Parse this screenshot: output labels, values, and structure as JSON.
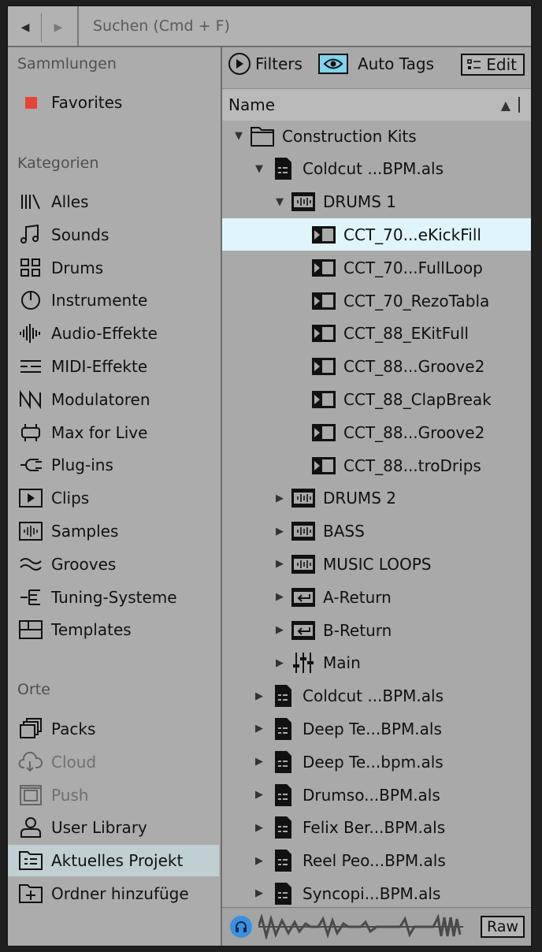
{
  "search": {
    "placeholder": "Suchen (Cmd + F)"
  },
  "sidebar": {
    "collections_header": "Sammlungen",
    "favorites_label": "Favorites",
    "favorites_color": "#e8433a",
    "categories_header": "Kategorien",
    "categories": [
      {
        "label": "Alles",
        "icon": "library-icon"
      },
      {
        "label": "Sounds",
        "icon": "music-note-icon"
      },
      {
        "label": "Drums",
        "icon": "drum-grid-icon"
      },
      {
        "label": "Instrumente",
        "icon": "power-knob-icon"
      },
      {
        "label": "Audio-Effekte",
        "icon": "waveform-icon"
      },
      {
        "label": "MIDI-Effekte",
        "icon": "midi-lines-icon"
      },
      {
        "label": "Modulatoren",
        "icon": "modulator-icon"
      },
      {
        "label": "Max for Live",
        "icon": "max-device-icon"
      },
      {
        "label": "Plug-ins",
        "icon": "plug-icon"
      },
      {
        "label": "Clips",
        "icon": "clip-icon"
      },
      {
        "label": "Samples",
        "icon": "sample-icon"
      },
      {
        "label": "Grooves",
        "icon": "groove-icon"
      },
      {
        "label": "Tuning-Systeme",
        "icon": "tuning-icon"
      },
      {
        "label": "Templates",
        "icon": "template-icon"
      }
    ],
    "places_header": "Orte",
    "places": [
      {
        "label": "Packs",
        "icon": "packs-icon"
      },
      {
        "label": "Cloud",
        "icon": "cloud-icon"
      },
      {
        "label": "Push",
        "icon": "push-icon"
      },
      {
        "label": "User Library",
        "icon": "user-icon"
      },
      {
        "label": "Aktuelles Projekt",
        "icon": "project-icon"
      },
      {
        "label": "Ordner hinzufüge",
        "icon": "add-folder-icon"
      }
    ]
  },
  "toolbar": {
    "filters_label": "Filters",
    "auto_tags_label": "Auto Tags",
    "edit_label": "Edit"
  },
  "browser": {
    "column_header": "Name",
    "rows": [
      {
        "label": "Construction Kits",
        "depth": 0,
        "expand": "open",
        "icon": "folder-icon"
      },
      {
        "label": "Coldcut ...BPM.als",
        "depth": 1,
        "expand": "open",
        "icon": "set-file-icon"
      },
      {
        "label": "DRUMS 1",
        "depth": 2,
        "expand": "open",
        "icon": "audio-track-icon"
      },
      {
        "label": "CCT_70...eKickFill",
        "depth": 3,
        "expand": "none",
        "icon": "clip-file-icon",
        "selected": true
      },
      {
        "label": "CCT_70...FullLoop",
        "depth": 3,
        "expand": "none",
        "icon": "clip-file-icon"
      },
      {
        "label": "CCT_70_RezoTabla",
        "depth": 3,
        "expand": "none",
        "icon": "clip-file-icon"
      },
      {
        "label": "CCT_88_EKitFull",
        "depth": 3,
        "expand": "none",
        "icon": "clip-file-icon"
      },
      {
        "label": "CCT_88...Groove2",
        "depth": 3,
        "expand": "none",
        "icon": "clip-file-icon"
      },
      {
        "label": "CCT_88_ClapBreak",
        "depth": 3,
        "expand": "none",
        "icon": "clip-file-icon"
      },
      {
        "label": "CCT_88...Groove2",
        "depth": 3,
        "expand": "none",
        "icon": "clip-file-icon"
      },
      {
        "label": "CCT_88...troDrips",
        "depth": 3,
        "expand": "none",
        "icon": "clip-file-icon"
      },
      {
        "label": "DRUMS 2",
        "depth": 2,
        "expand": "closed",
        "icon": "audio-track-icon"
      },
      {
        "label": "BASS",
        "depth": 2,
        "expand": "closed",
        "icon": "audio-track-icon"
      },
      {
        "label": "MUSIC LOOPS",
        "depth": 2,
        "expand": "closed",
        "icon": "audio-track-icon"
      },
      {
        "label": "A-Return",
        "depth": 2,
        "expand": "closed",
        "icon": "return-track-icon"
      },
      {
        "label": "B-Return",
        "depth": 2,
        "expand": "closed",
        "icon": "return-track-icon"
      },
      {
        "label": "Main",
        "depth": 2,
        "expand": "closed",
        "icon": "mixer-icon"
      },
      {
        "label": "Coldcut ...BPM.als",
        "depth": 1,
        "expand": "closed",
        "icon": "set-file-icon"
      },
      {
        "label": "Deep Te...BPM.als",
        "depth": 1,
        "expand": "closed",
        "icon": "set-file-icon"
      },
      {
        "label": "Deep Te...bpm.als",
        "depth": 1,
        "expand": "closed",
        "icon": "set-file-icon"
      },
      {
        "label": "Drumso...BPM.als",
        "depth": 1,
        "expand": "closed",
        "icon": "set-file-icon"
      },
      {
        "label": "Felix Ber...BPM.als",
        "depth": 1,
        "expand": "closed",
        "icon": "set-file-icon"
      },
      {
        "label": "Reel Peo...BPM.als",
        "depth": 1,
        "expand": "closed",
        "icon": "set-file-icon"
      },
      {
        "label": "Syncopi...BPM.als",
        "depth": 1,
        "expand": "closed",
        "icon": "set-file-icon"
      }
    ]
  },
  "preview": {
    "raw_label": "Raw"
  },
  "colors": {
    "selected_row": "#dff5fb",
    "selected_place": "#bfcfd2",
    "auto_tags_active": "#7fd4ef",
    "preview_button": "#3a8fe0"
  }
}
